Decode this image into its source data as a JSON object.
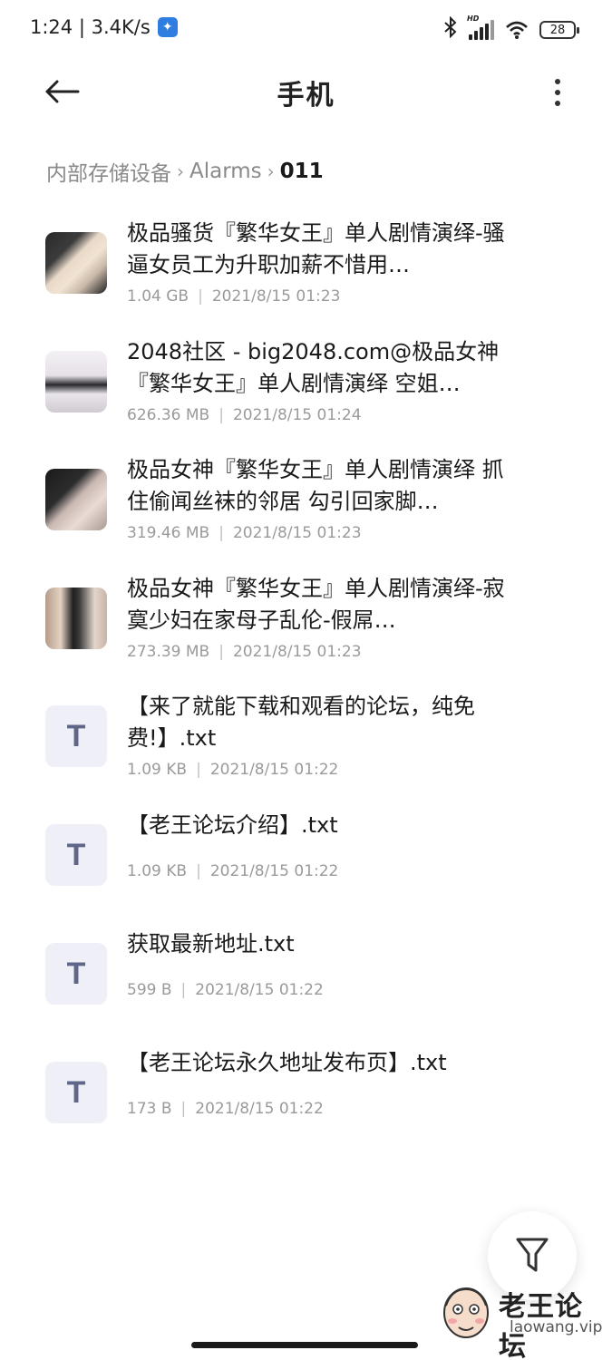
{
  "status_bar": {
    "time_speed": "1:24 | 3.4K/s",
    "hd_label": "HD",
    "battery": "28"
  },
  "header": {
    "title": "手机"
  },
  "breadcrumb": {
    "items": [
      "内部存储设备",
      "Alarms",
      "011"
    ]
  },
  "files": [
    {
      "name": "极品骚货『繁华女王』单人剧情演绎-骚逼女员工为升职加薪不惜用…",
      "size": "1.04 GB",
      "date": "2021/8/15 01:23",
      "type": "video"
    },
    {
      "name": "2048社区 - big2048.com@极品女神『繁华女王』单人剧情演绎 空姐…",
      "size": "626.36 MB",
      "date": "2021/8/15 01:24",
      "type": "video"
    },
    {
      "name": "极品女神『繁华女王』单人剧情演绎 抓住偷闻丝袜的邻居 勾引回家脚…",
      "size": "319.46 MB",
      "date": "2021/8/15 01:23",
      "type": "video"
    },
    {
      "name": "极品女神『繁华女王』单人剧情演绎-寂寞少妇在家母子乱伦-假屌…",
      "size": "273.39 MB",
      "date": "2021/8/15 01:23",
      "type": "video"
    },
    {
      "name": "【来了就能下载和观看的论坛，纯免费!】.txt",
      "size": "1.09 KB",
      "date": "2021/8/15 01:22",
      "type": "txt",
      "icon_letter": "T"
    },
    {
      "name": "【老王论坛介绍】.txt",
      "size": "1.09 KB",
      "date": "2021/8/15 01:22",
      "type": "txt",
      "icon_letter": "T"
    },
    {
      "name": "获取最新地址.txt",
      "size": "599 B",
      "date": "2021/8/15 01:22",
      "type": "txt",
      "icon_letter": "T"
    },
    {
      "name": "【老王论坛永久地址发布页】.txt",
      "size": "173 B",
      "date": "2021/8/15 01:22",
      "type": "txt",
      "icon_letter": "T"
    }
  ],
  "meta_separator": "|",
  "watermark": {
    "title": "老王论坛",
    "url": "laowang.vip"
  },
  "icons": {
    "back": "back-arrow-icon",
    "more": "more-vertical-icon",
    "filter": "filter-icon",
    "txt": "text-file-icon"
  },
  "colors": {
    "txt_icon_bg": "#eff0f7",
    "txt_icon_fg": "#5f6688",
    "meta_text": "#9a9a9a"
  }
}
